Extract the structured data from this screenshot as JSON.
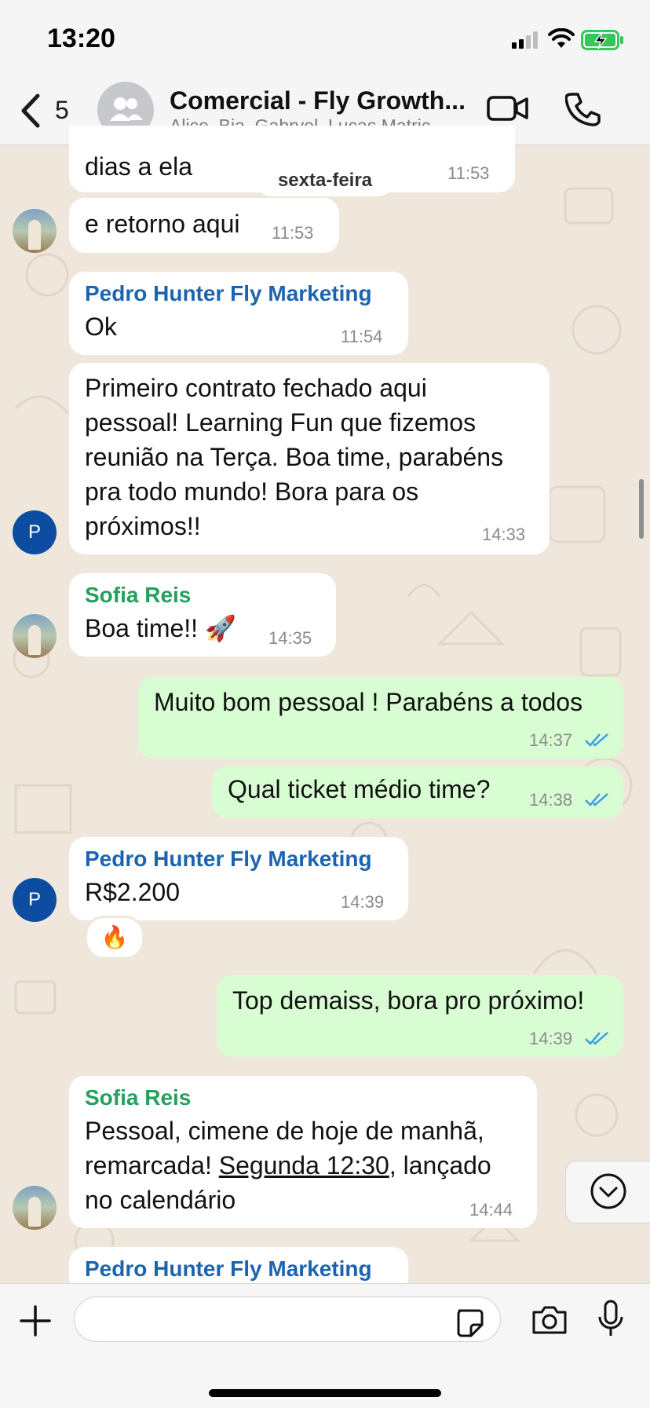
{
  "status_bar": {
    "time": "13:20"
  },
  "header": {
    "back_count": "5",
    "title": "Comercial - Fly Growth...",
    "subtitle": "Alice, Bia, Gabryel, Lucas Matric..."
  },
  "date_divider": "sexta-feira",
  "messages": [
    {
      "sender": "",
      "text": "dias a ela",
      "time": "11:53",
      "direction": "in"
    },
    {
      "sender": "",
      "text": "e retorno aqui",
      "time": "11:53",
      "direction": "in"
    },
    {
      "sender": "Pedro Hunter Fly Marketing",
      "text": "Ok",
      "time": "11:54",
      "direction": "in",
      "avatar": "P"
    },
    {
      "sender": "",
      "lines": [
        "Primeiro contrato fechado aqui",
        "pessoal! Learning Fun que fizemos",
        "reunião na Terça. Boa time, parabéns",
        "pra todo mundo! Bora para os",
        "próximos!!"
      ],
      "time": "14:33",
      "direction": "in",
      "avatar": "P"
    },
    {
      "sender": "Sofia Reis",
      "text": "Boa time!! 🚀",
      "time": "14:35",
      "direction": "in"
    },
    {
      "sender": "",
      "text": "Muito bom pessoal ! Parabéns a todos",
      "time": "14:37",
      "direction": "out"
    },
    {
      "sender": "",
      "text": "Qual ticket médio time?",
      "time": "14:38",
      "direction": "out"
    },
    {
      "sender": "Pedro Hunter Fly Marketing",
      "text": "R$2.200",
      "time": "14:39",
      "direction": "in",
      "avatar": "P",
      "reaction": "🔥"
    },
    {
      "sender": "",
      "text": "Top demaiss, bora pro próximo!",
      "time": "14:39",
      "direction": "out"
    },
    {
      "sender": "Sofia Reis",
      "lines": [
        "Pessoal, cimene de hoje de manhã,",
        "remarcada!",
        "Segunda 12:30",
        ", lançado",
        "no calendário"
      ],
      "time": "14:44",
      "direction": "in"
    },
    {
      "sender": "Pedro Hunter Fly Marketing",
      "text": "",
      "time": "",
      "direction": "in"
    }
  ],
  "colors": {
    "chat_background": "#efe7dc",
    "incoming_bubble": "#ffffff",
    "outgoing_bubble": "#d9fdd3",
    "sender_blue": "#1d64b0",
    "sender_green": "#25a05c",
    "read_ticks": "#3d9ee8",
    "avatar_blue": "#0d4da1",
    "battery_green": "#34c759"
  },
  "icons": [
    "chevron-left-icon",
    "group-icon",
    "video-call-icon",
    "phone-call-icon",
    "plus-icon",
    "sticker-icon",
    "camera-icon",
    "microphone-icon",
    "chevron-down-icon",
    "double-check-icon"
  ]
}
